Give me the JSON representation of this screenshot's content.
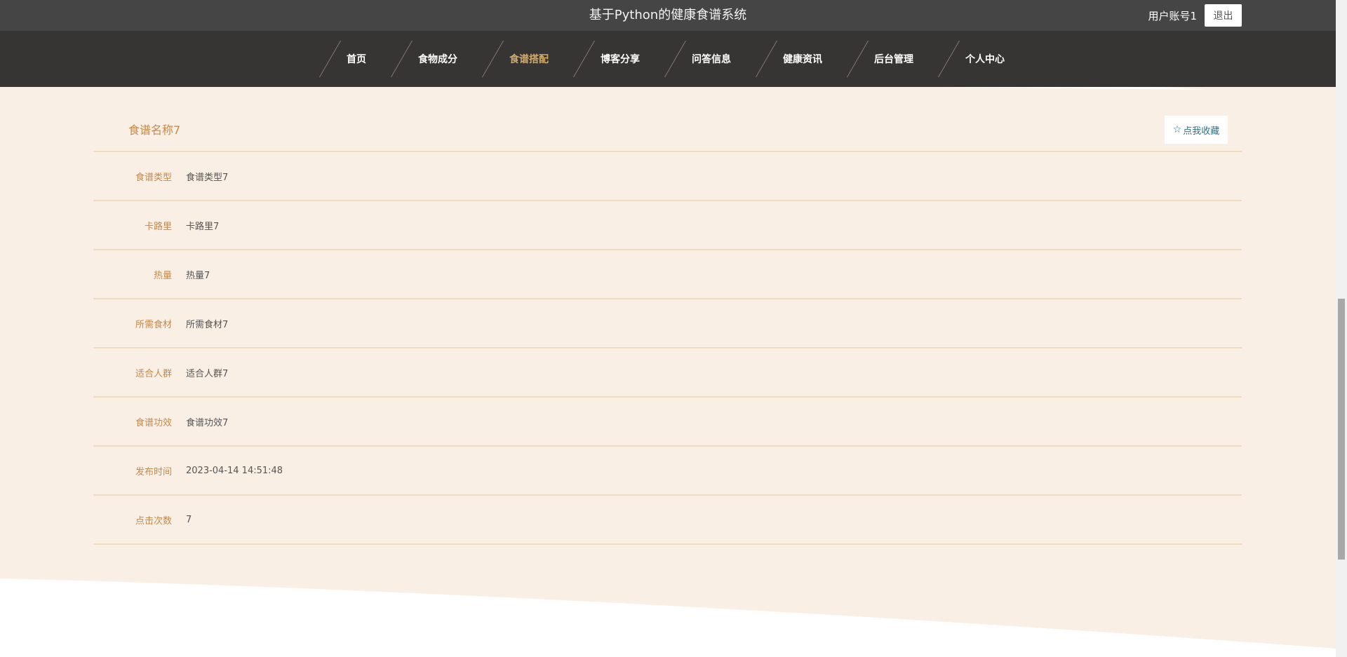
{
  "header": {
    "site_title": "基于Python的健康食谱系统",
    "username": "用户账号1",
    "logout_label": "退出"
  },
  "nav": {
    "items": [
      {
        "label": "首页",
        "active": false
      },
      {
        "label": "食物成分",
        "active": false
      },
      {
        "label": "食谱搭配",
        "active": true
      },
      {
        "label": "博客分享",
        "active": false
      },
      {
        "label": "问答信息",
        "active": false
      },
      {
        "label": "健康资讯",
        "active": false
      },
      {
        "label": "后台管理",
        "active": false
      },
      {
        "label": "个人中心",
        "active": false
      }
    ]
  },
  "detail": {
    "title": "食谱名称7",
    "favorite_label": "点我收藏",
    "favorite_icon": "star-outline-icon",
    "fields": [
      {
        "label": "食谱类型",
        "value": "食谱类型7"
      },
      {
        "label": "卡路里",
        "value": "卡路里7"
      },
      {
        "label": "热量",
        "value": "热量7"
      },
      {
        "label": "所需食材",
        "value": "所需食材7"
      },
      {
        "label": "适合人群",
        "value": "适合人群7"
      },
      {
        "label": "食谱功效",
        "value": "食谱功效7"
      },
      {
        "label": "发布时间",
        "value": "2023-04-14 14:51:48"
      },
      {
        "label": "点击次数",
        "value": "7"
      }
    ]
  },
  "colors": {
    "topbar_bg": "#454545",
    "navbar_bg": "#363533",
    "accent": "#c4894b",
    "nav_active": "#d1a96b",
    "content_bg": "#faefe4",
    "divider": "#efdcc0",
    "favorite_text": "#2f7180"
  }
}
